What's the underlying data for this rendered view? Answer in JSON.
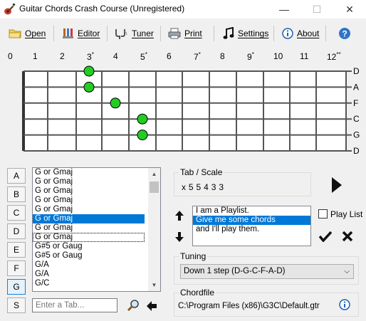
{
  "window": {
    "title": "Guitar Chords Crash Course (Unregistered)",
    "controls": {
      "minimize": "—",
      "maximize": "☐",
      "close": "✕"
    }
  },
  "toolbar": {
    "items": [
      {
        "label": "Open",
        "icon": "folder-icon"
      },
      {
        "label": "Editor",
        "icon": "brush-icon"
      },
      {
        "label": "Tuner",
        "icon": "tuning-fork-icon"
      },
      {
        "label": "Print",
        "icon": "printer-icon"
      },
      {
        "label": "Settings",
        "icon": "music-note-icon"
      },
      {
        "label": "About",
        "icon": "info-icon"
      }
    ],
    "help_icon": "help-icon"
  },
  "fretboard": {
    "fret_labels": [
      "0",
      "1",
      "2",
      "3",
      "4",
      "5",
      "6",
      "7",
      "8",
      "9",
      "10",
      "11",
      "12"
    ],
    "fret_marks": {
      "3": "*",
      "5": "*",
      "7": "*",
      "9": "*",
      "12": "**"
    },
    "strings": [
      "D",
      "A",
      "F",
      "C",
      "G",
      "D"
    ],
    "notes": [
      {
        "string": 0,
        "fret": 3
      },
      {
        "string": 1,
        "fret": 3
      },
      {
        "string": 2,
        "fret": 4
      },
      {
        "string": 3,
        "fret": 5
      },
      {
        "string": 4,
        "fret": 5
      }
    ],
    "colors": {
      "note": "#22cc22",
      "board": "#ffffff",
      "lines": "#555555"
    }
  },
  "key_buttons": [
    "A",
    "B",
    "C",
    "D",
    "E",
    "F",
    "G",
    "S"
  ],
  "selected_key": "G",
  "chord_list": {
    "items": [
      "G or Gmaj",
      "G or Gmaj",
      "G or Gmaj",
      "G or Gmaj",
      "G or Gmaj",
      "G or Gmaj",
      "G or Gmaj",
      "G or Gmaj",
      "G#5 or Gaug",
      "G#5 or Gaug",
      "G/A",
      "G/A",
      "G/C"
    ],
    "selected_index": 5,
    "focused_index": 7
  },
  "tab_entry": {
    "placeholder": "Enter a Tab..."
  },
  "tab_scale": {
    "title": "Tab / Scale",
    "value": "x 5 5 4 3 3"
  },
  "playlist": {
    "items": [
      "I am a Playlist.",
      "Give me some chords",
      "and I'll play them."
    ],
    "selected_index": 1,
    "checkbox_label": "Play List"
  },
  "tuning": {
    "title": "Tuning",
    "selected": "Down 1 step (D-G-C-F-A-D)"
  },
  "chordfile": {
    "title": "Chordfile",
    "path": "C:\\Program Files (x86)\\G3C\\Default.gtr"
  }
}
